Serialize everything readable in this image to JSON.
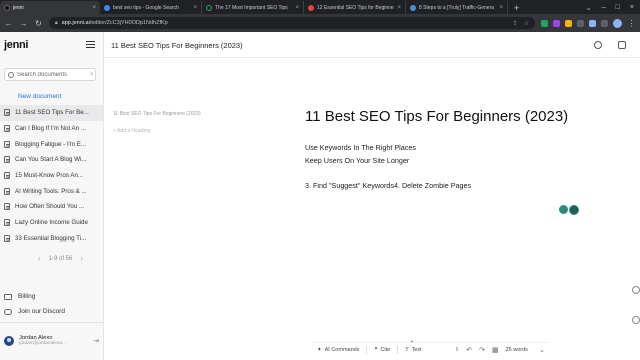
{
  "browser": {
    "tabs": [
      {
        "title": "jenni",
        "color": "#1a1a1a",
        "active": true
      },
      {
        "title": "best seo tips - Google Search",
        "color": "#4285f4",
        "active": false
      },
      {
        "title": "The 17 Most Important SEO Tips",
        "color": "#34a853",
        "active": false
      },
      {
        "title": "12 Essential SEO Tips for Beginne",
        "color": "#ea4335",
        "active": false
      },
      {
        "title": "8 Steps to a [Truly] Traffic-Genera",
        "color": "#4a90e2",
        "active": false
      }
    ],
    "url_host": "app.jenni.ai",
    "url_path": "/editor/ZcC3jYH0ODp1NdhZfKp"
  },
  "sidebar": {
    "logo": "jenni",
    "search_placeholder": "Search documents",
    "new_document": "New document",
    "documents": [
      "11 Best SEO Tips For Be...",
      "Can I Blog If I'm Not An ...",
      "Blogging Fatigue - I'm E...",
      "Can You Start A Blog Wi...",
      "15 Must-Know Pros An...",
      "AI Writing Tools: Pros & ...",
      "How Often Should You ...",
      "Lazy Online Income Guide",
      "33 Essential Blogging Ti..."
    ],
    "pagination": "1-9 of 56",
    "billing": "Billing",
    "discord": "Join our Discord",
    "user_name": "Jordan Alexo",
    "user_email": "jordan@jordanalexo..."
  },
  "editor": {
    "header_title": "11 Best SEO Tips For Beginners (2023)",
    "outline_title": "11 Best SEO Tips For Beginners (2023)",
    "outline_add": "+ Add a Heading",
    "title": "11 Best SEO Tips For Beginners (2023)",
    "lines": [
      "Use Keywords In The Right Places",
      "Keep Users On Your Site Longer",
      "3. Find \"Suggest\" Keywords4. Delete Zombie Pages"
    ]
  },
  "toolbar": {
    "ai_commands": "AI Commands",
    "cite": "Cite",
    "text_style": "Text",
    "word_count": "26 words"
  }
}
